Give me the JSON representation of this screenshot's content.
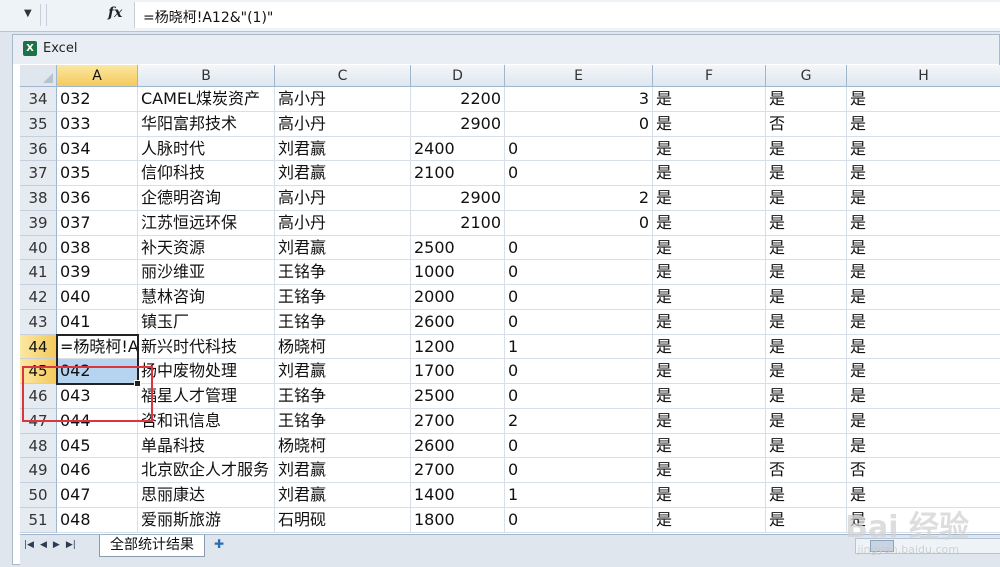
{
  "formula_bar": {
    "name_box_arrow": "▼",
    "fx_label": "fx",
    "formula": "=杨晓柯!A12&\"(1)\""
  },
  "window": {
    "title": "Excel"
  },
  "columns": [
    "A",
    "B",
    "C",
    "D",
    "E",
    "F",
    "G",
    "H"
  ],
  "selected": {
    "col": "A",
    "rows": [
      "44",
      "45"
    ]
  },
  "rows": [
    {
      "n": "34",
      "a": "032",
      "b": "CAMEL煤炭资产",
      "c": "高小丹",
      "d": "2200",
      "e": "3",
      "f": "是",
      "g": "是",
      "h": "是"
    },
    {
      "n": "35",
      "a": "033",
      "b": "华阳富邦技术",
      "c": "高小丹",
      "d": "2900",
      "e": "0",
      "f": "是",
      "g": "否",
      "h": "是"
    },
    {
      "n": "36",
      "a": "034",
      "b": "人脉时代",
      "c": "刘君赢",
      "d": "2400",
      "e": "0",
      "f": "是",
      "g": "是",
      "h": "是"
    },
    {
      "n": "37",
      "a": "035",
      "b": "信仰科技",
      "c": "刘君赢",
      "d": "2100",
      "e": "0",
      "f": "是",
      "g": "是",
      "h": "是"
    },
    {
      "n": "38",
      "a": "036",
      "b": "企德明咨询",
      "c": "高小丹",
      "d": "2900",
      "e": "2",
      "f": "是",
      "g": "是",
      "h": "是"
    },
    {
      "n": "39",
      "a": "037",
      "b": "江苏恒远环保",
      "c": "高小丹",
      "d": "2100",
      "e": "0",
      "f": "是",
      "g": "是",
      "h": "是"
    },
    {
      "n": "40",
      "a": "038",
      "b": "补天资源",
      "c": "刘君赢",
      "d": "2500",
      "e": "0",
      "f": "是",
      "g": "是",
      "h": "是"
    },
    {
      "n": "41",
      "a": "039",
      "b": "丽沙维亚",
      "c": "王铭争",
      "d": "1000",
      "e": "0",
      "f": "是",
      "g": "是",
      "h": "是"
    },
    {
      "n": "42",
      "a": "040",
      "b": "慧林咨询",
      "c": "王铭争",
      "d": "2000",
      "e": "0",
      "f": "是",
      "g": "是",
      "h": "是"
    },
    {
      "n": "43",
      "a": "041",
      "b": "镇玉厂",
      "c": "王铭争",
      "d": "2600",
      "e": "0",
      "f": "是",
      "g": "是",
      "h": "是"
    },
    {
      "n": "44",
      "a": "=杨晓柯!A12&\"(1)\"",
      "b": "新兴时代科技",
      "c": "杨晓柯",
      "d": "1200",
      "e": "1",
      "f": "是",
      "g": "是",
      "h": "是"
    },
    {
      "n": "45",
      "a": "042",
      "b": "扬中废物处理",
      "c": "刘君赢",
      "d": "1700",
      "e": "0",
      "f": "是",
      "g": "是",
      "h": "是"
    },
    {
      "n": "46",
      "a": "043",
      "b": "福星人才管理",
      "c": "王铭争",
      "d": "2500",
      "e": "0",
      "f": "是",
      "g": "是",
      "h": "是"
    },
    {
      "n": "47",
      "a": "044",
      "b": "咨和讯信息",
      "c": "王铭争",
      "d": "2700",
      "e": "2",
      "f": "是",
      "g": "是",
      "h": "是"
    },
    {
      "n": "48",
      "a": "045",
      "b": "单晶科技",
      "c": "杨晓柯",
      "d": "2600",
      "e": "0",
      "f": "是",
      "g": "是",
      "h": "是"
    },
    {
      "n": "49",
      "a": "046",
      "b": "北京欧企人才服务",
      "c": "刘君赢",
      "d": "2700",
      "e": "0",
      "f": "是",
      "g": "否",
      "h": "否"
    },
    {
      "n": "50",
      "a": "047",
      "b": "思丽康达",
      "c": "刘君赢",
      "d": "1400",
      "e": "1",
      "f": "是",
      "g": "是",
      "h": "是"
    },
    {
      "n": "51",
      "a": "048",
      "b": "爱丽斯旅游",
      "c": "石明砚",
      "d": "1800",
      "e": "0",
      "f": "是",
      "g": "是",
      "h": "是"
    }
  ],
  "right_aligned_rows": [
    "34",
    "35",
    "38",
    "39"
  ],
  "sheet_tab": "全部统计结果",
  "watermark": {
    "logo": "Bai 经验",
    "url": "jingyan.baidu.com"
  }
}
